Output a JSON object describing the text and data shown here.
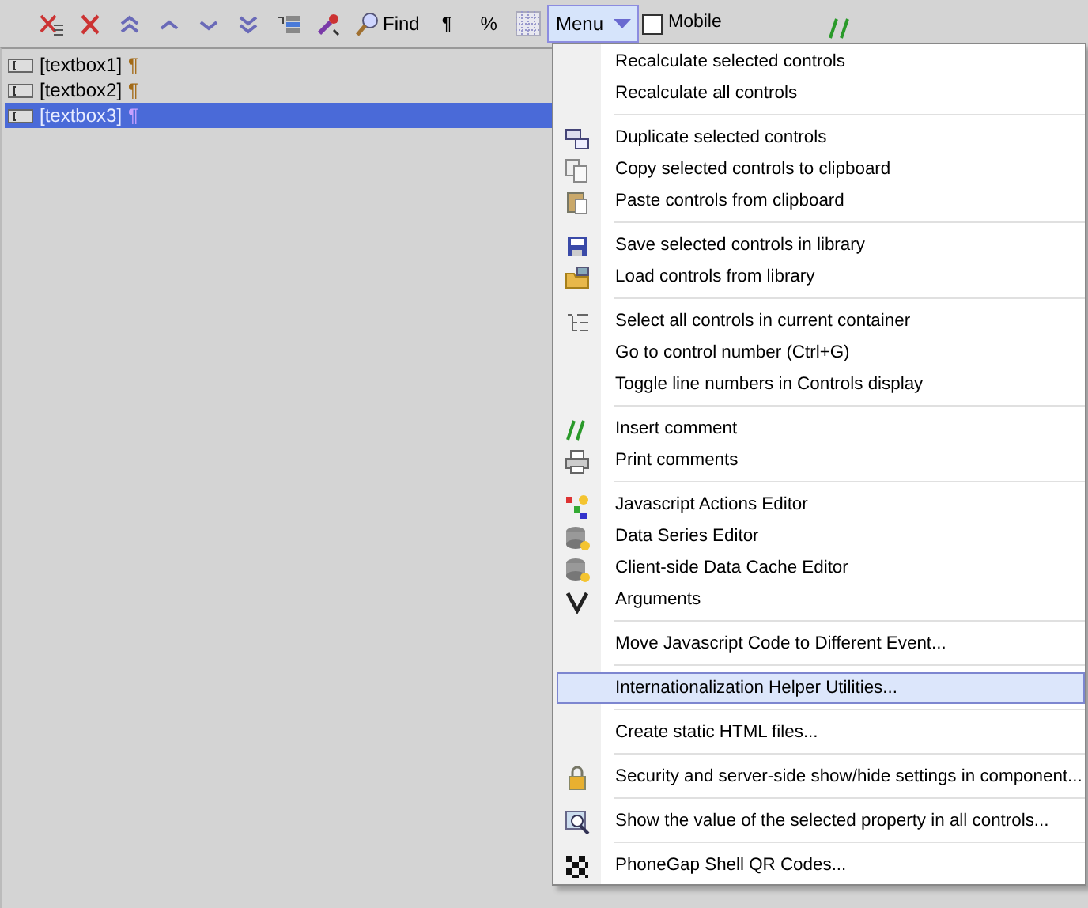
{
  "toolbar": {
    "find_label": "Find",
    "pilcrow": "¶",
    "percent": "%",
    "menu_button": "Menu",
    "mobile": {
      "label": "Mobile",
      "checked": false
    }
  },
  "tree": [
    {
      "label": "[textbox1]",
      "mark": "¶",
      "selected": false
    },
    {
      "label": "[textbox2]",
      "mark": "¶",
      "selected": false
    },
    {
      "label": "[textbox3]",
      "mark": "¶",
      "selected": true
    }
  ],
  "menu": {
    "sections": [
      {
        "items": [
          {
            "label": "Recalculate selected controls",
            "highlighted": false
          },
          {
            "label": "Recalculate all controls",
            "highlighted": false
          }
        ]
      },
      {
        "items": [
          {
            "label": "Duplicate selected controls",
            "highlighted": false
          },
          {
            "label": "Copy selected controls to clipboard",
            "highlighted": false
          },
          {
            "label": "Paste controls from clipboard",
            "highlighted": false
          }
        ]
      },
      {
        "items": [
          {
            "label": "Save selected controls in library",
            "highlighted": false
          },
          {
            "label": "Load controls from library",
            "highlighted": false
          }
        ]
      },
      {
        "items": [
          {
            "label": "Select all controls in current container",
            "highlighted": false
          },
          {
            "label": "Go to control number (Ctrl+G)",
            "highlighted": false
          },
          {
            "label": "Toggle line numbers in Controls display",
            "highlighted": false
          }
        ]
      },
      {
        "items": [
          {
            "label": "Insert comment",
            "highlighted": false
          },
          {
            "label": "Print comments",
            "highlighted": false
          }
        ]
      },
      {
        "items": [
          {
            "label": "Javascript Actions Editor",
            "highlighted": false
          },
          {
            "label": "Data Series Editor",
            "highlighted": false
          },
          {
            "label": "Client-side Data Cache Editor",
            "highlighted": false
          },
          {
            "label": "Arguments",
            "highlighted": false
          }
        ]
      },
      {
        "items": [
          {
            "label": "Move Javascript Code to Different Event...",
            "highlighted": false
          }
        ]
      },
      {
        "items": [
          {
            "label": "Internationalization Helper Utilities...",
            "highlighted": true
          }
        ]
      },
      {
        "items": [
          {
            "label": "Create static HTML files...",
            "highlighted": false
          }
        ]
      },
      {
        "items": [
          {
            "label": "Security and server-side show/hide settings in component...",
            "highlighted": false
          }
        ]
      },
      {
        "items": [
          {
            "label": "Show the value of the selected property in all controls...",
            "highlighted": false
          }
        ]
      },
      {
        "items": [
          {
            "label": "PhoneGap Shell QR Codes...",
            "highlighted": false
          }
        ]
      }
    ]
  }
}
